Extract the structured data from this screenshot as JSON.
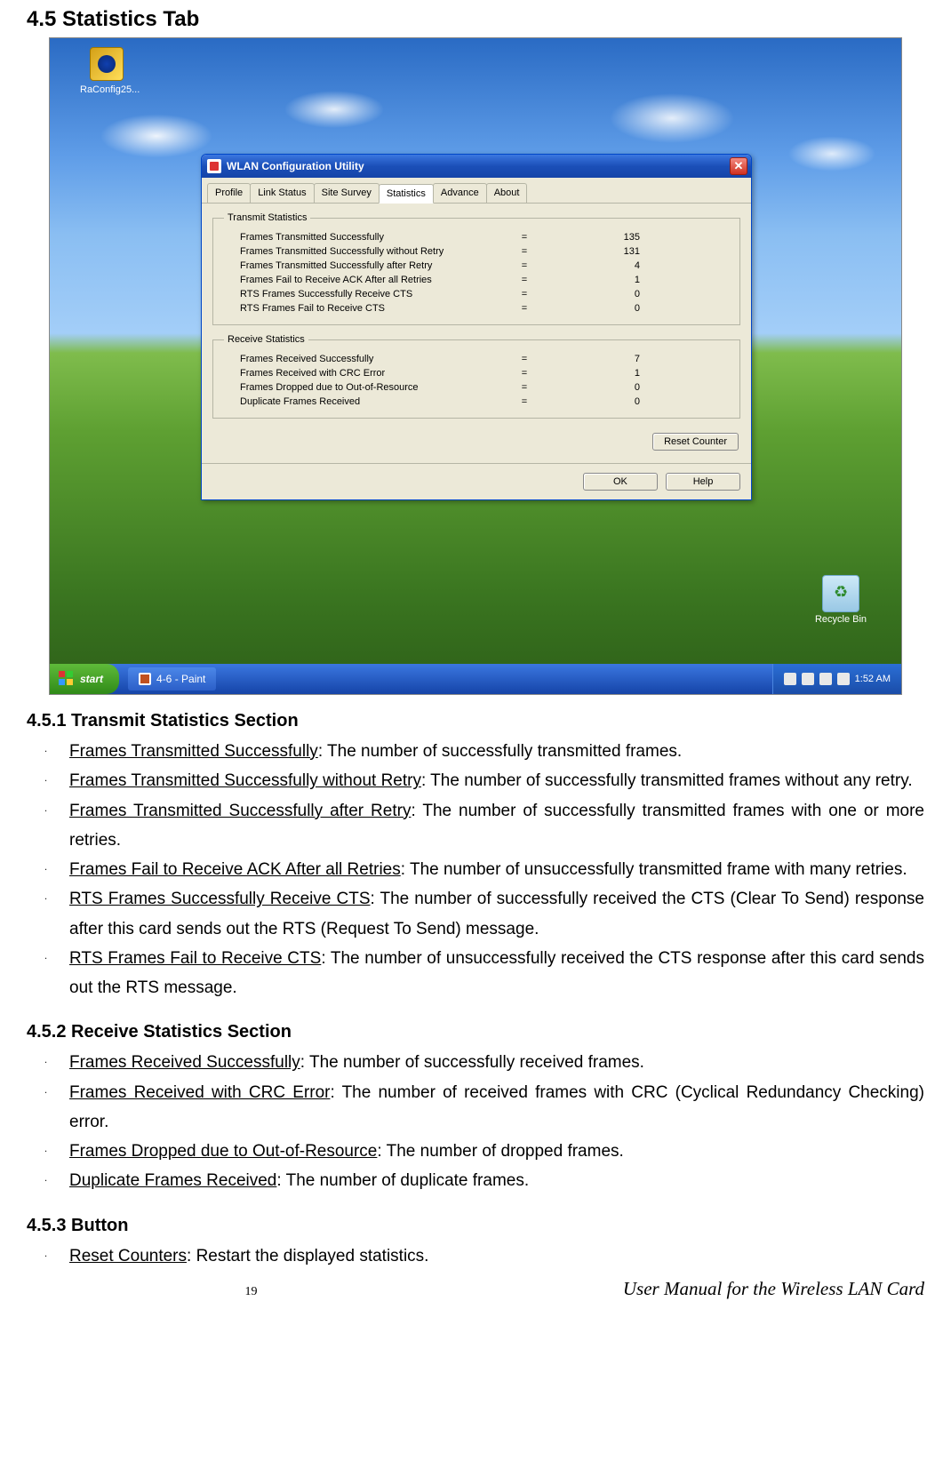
{
  "headings": {
    "main": "4.5 Statistics Tab",
    "s1": "4.5.1 Transmit Statistics Section",
    "s2": "4.5.2 Receive Statistics Section",
    "s3": "4.5.3 Button"
  },
  "desktop": {
    "raconfig_label": "RaConfig25...",
    "recycle_label": "Recycle Bin"
  },
  "window": {
    "title": "WLAN Configuration Utility",
    "close_glyph": "✕",
    "tabs": {
      "profile": "Profile",
      "link_status": "Link Status",
      "site_survey": "Site Survey",
      "statistics": "Statistics",
      "advance": "Advance",
      "about": "About"
    },
    "tx_legend": "Transmit Statistics",
    "rx_legend": "Receive Statistics",
    "eq": "=",
    "tx": {
      "r0": {
        "l": "Frames Transmitted Successfully",
        "v": "135"
      },
      "r1": {
        "l": "Frames Transmitted Successfully without Retry",
        "v": "131"
      },
      "r2": {
        "l": "Frames Transmitted Successfully after Retry",
        "v": "4"
      },
      "r3": {
        "l": "Frames Fail to Receive ACK After all Retries",
        "v": "1"
      },
      "r4": {
        "l": "RTS Frames Successfully Receive CTS",
        "v": "0"
      },
      "r5": {
        "l": "RTS Frames Fail to Receive CTS",
        "v": "0"
      }
    },
    "rx": {
      "r0": {
        "l": "Frames Received Successfully",
        "v": "7"
      },
      "r1": {
        "l": "Frames Received with CRC Error",
        "v": "1"
      },
      "r2": {
        "l": "Frames Dropped due to Out-of-Resource",
        "v": "0"
      },
      "r3": {
        "l": "Duplicate Frames Received",
        "v": "0"
      }
    },
    "buttons": {
      "reset": "Reset Counter",
      "ok": "OK",
      "help": "Help"
    }
  },
  "taskbar": {
    "start": "start",
    "task": "4-6 - Paint",
    "time": "1:52 AM"
  },
  "desc": {
    "s1": {
      "b0": {
        "t": "Frames Transmitted Successfully",
        "r": ": The number of successfully transmitted frames."
      },
      "b1": {
        "t": "Frames Transmitted Successfully without Retry",
        "r": ": The number of successfully transmitted frames without any retry."
      },
      "b2": {
        "t": "Frames Transmitted Successfully after Retry",
        "r": ": The number of successfully transmitted frames with one or more retries."
      },
      "b3": {
        "t": "Frames Fail to Receive ACK After all Retries",
        "r": ": The number of unsuccessfully transmitted frame with many retries."
      },
      "b4": {
        "t": "RTS Frames Successfully Receive CTS",
        "r": ": The number of successfully received the CTS (Clear To Send) response after this card sends out the RTS (Request To Send) message."
      },
      "b5": {
        "t": "RTS Frames Fail to Receive CTS",
        "r": ": The number of unsuccessfully received the CTS response after this card sends out the RTS message."
      }
    },
    "s2": {
      "b0": {
        "t": "Frames Received Successfully",
        "r": ": The number of successfully received frames."
      },
      "b1": {
        "t": "Frames Received with CRC Error",
        "r": ": The number of received frames with CRC (Cyclical Redundancy Checking) error."
      },
      "b2": {
        "t": "Frames Dropped due to Out-of-Resource",
        "r": ": The number of dropped frames."
      },
      "b3": {
        "t": "Duplicate Frames Received",
        "r": ": The number of duplicate frames."
      }
    },
    "s3": {
      "b0": {
        "t": "Reset Counters",
        "r": ": Restart the displayed statistics."
      }
    }
  },
  "footer": {
    "page": "19",
    "book": "User Manual for the Wireless LAN Card"
  }
}
